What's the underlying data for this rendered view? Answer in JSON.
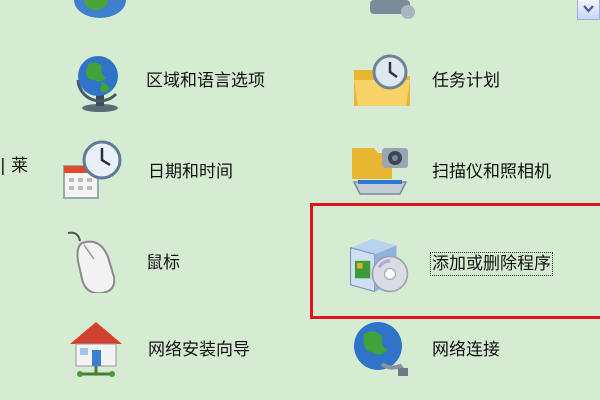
{
  "sidebar": {
    "partial_label": "| 莱"
  },
  "items": [
    {
      "label": "区域和语言选项",
      "icon": "globe-clock-icon"
    },
    {
      "label": "任务计划",
      "icon": "folder-clock-icon"
    },
    {
      "label": "日期和时间",
      "icon": "calendar-clock-icon"
    },
    {
      "label": "扫描仪和照相机",
      "icon": "scanner-camera-icon"
    },
    {
      "label": "鼠标",
      "icon": "mouse-icon"
    },
    {
      "label": "添加或删除程序",
      "icon": "cd-box-icon"
    },
    {
      "label": "网络安装向导",
      "icon": "house-network-icon"
    },
    {
      "label": "网络连接",
      "icon": "globe-plug-icon"
    }
  ],
  "colors": {
    "background": "#d6ecd2",
    "highlight": "#e2141b",
    "selected_outline": "#333333"
  },
  "scrollbar": {
    "icon": "chevron-down-icon"
  }
}
